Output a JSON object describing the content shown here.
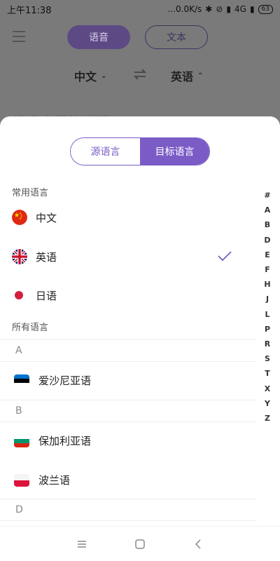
{
  "status": {
    "time": "上午11:38",
    "network_speed": "...0.0K/s",
    "network_type": "4G",
    "battery": "63"
  },
  "background": {
    "mode_voice": "语音",
    "mode_text": "文本",
    "source_lang": "中文",
    "target_lang": "英语",
    "hint_text": "请点击开始说话"
  },
  "sheet": {
    "tabs": {
      "source": "源语言",
      "target": "目标语言"
    },
    "common_title": "常用语言",
    "common_languages": [
      {
        "name": "中文",
        "flag": "china-flag"
      },
      {
        "name": "英语",
        "flag": "uk-flag",
        "selected": true
      },
      {
        "name": "日语",
        "flag": "japan-flag"
      }
    ],
    "all_title": "所有语言",
    "groups": [
      {
        "letter": "A",
        "languages": [
          {
            "name": "爱沙尼亚语",
            "flag": "estonia-flag"
          }
        ]
      },
      {
        "letter": "B",
        "languages": [
          {
            "name": "保加利亚语",
            "flag": "bulgaria-flag"
          },
          {
            "name": "波兰语",
            "flag": "poland-flag"
          }
        ]
      },
      {
        "letter": "D",
        "languages": []
      }
    ],
    "index": [
      "#",
      "A",
      "B",
      "D",
      "E",
      "F",
      "H",
      "J",
      "L",
      "P",
      "R",
      "S",
      "T",
      "X",
      "Y",
      "Z"
    ]
  },
  "colors": {
    "accent": "#7b5cc7",
    "dim_overlay": "#7a7a7a"
  }
}
